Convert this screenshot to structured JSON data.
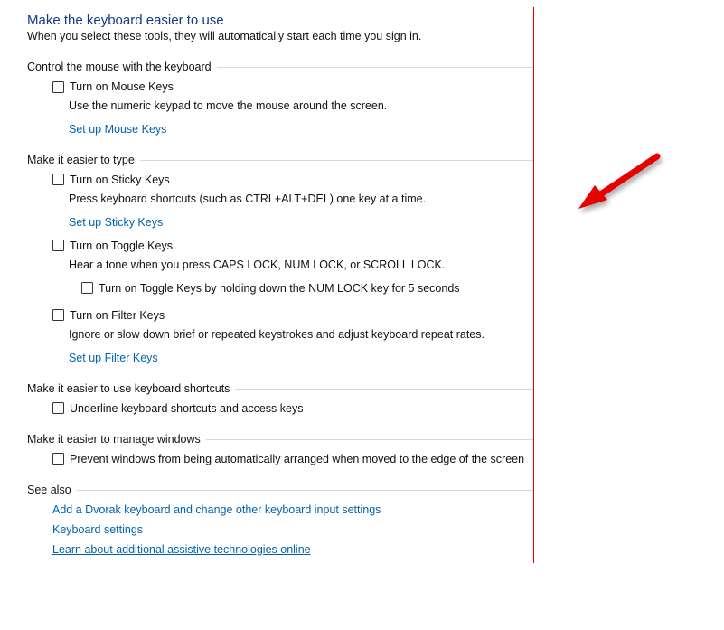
{
  "page": {
    "title": "Make the keyboard easier to use",
    "subtitle": "When you select these tools, they will automatically start each time you sign in."
  },
  "sections": {
    "mouseKeys": {
      "header": "Control the mouse with the keyboard",
      "checkbox": "Turn on Mouse Keys",
      "description": "Use the numeric keypad to move the mouse around the screen.",
      "link": "Set up Mouse Keys"
    },
    "easierType": {
      "header": "Make it easier to type",
      "sticky": {
        "checkbox": "Turn on Sticky Keys",
        "description": "Press keyboard shortcuts (such as CTRL+ALT+DEL) one key at a time.",
        "link": "Set up Sticky Keys"
      },
      "toggle": {
        "checkbox": "Turn on Toggle Keys",
        "description": "Hear a tone when you press CAPS LOCK, NUM LOCK, or SCROLL LOCK.",
        "nestedCheckbox": "Turn on Toggle Keys by holding down the NUM LOCK key for 5 seconds"
      },
      "filter": {
        "checkbox": "Turn on Filter Keys",
        "description": "Ignore or slow down brief or repeated keystrokes and adjust keyboard repeat rates.",
        "link": "Set up Filter Keys"
      }
    },
    "shortcuts": {
      "header": "Make it easier to use keyboard shortcuts",
      "checkbox": "Underline keyboard shortcuts and access keys"
    },
    "windows": {
      "header": "Make it easier to manage windows",
      "checkbox": "Prevent windows from being automatically arranged when moved to the edge of the screen"
    },
    "seeAlso": {
      "header": "See also",
      "link1": "Add a Dvorak keyboard and change other keyboard input settings",
      "link2": "Keyboard settings",
      "link3": "Learn about additional assistive technologies online"
    }
  }
}
